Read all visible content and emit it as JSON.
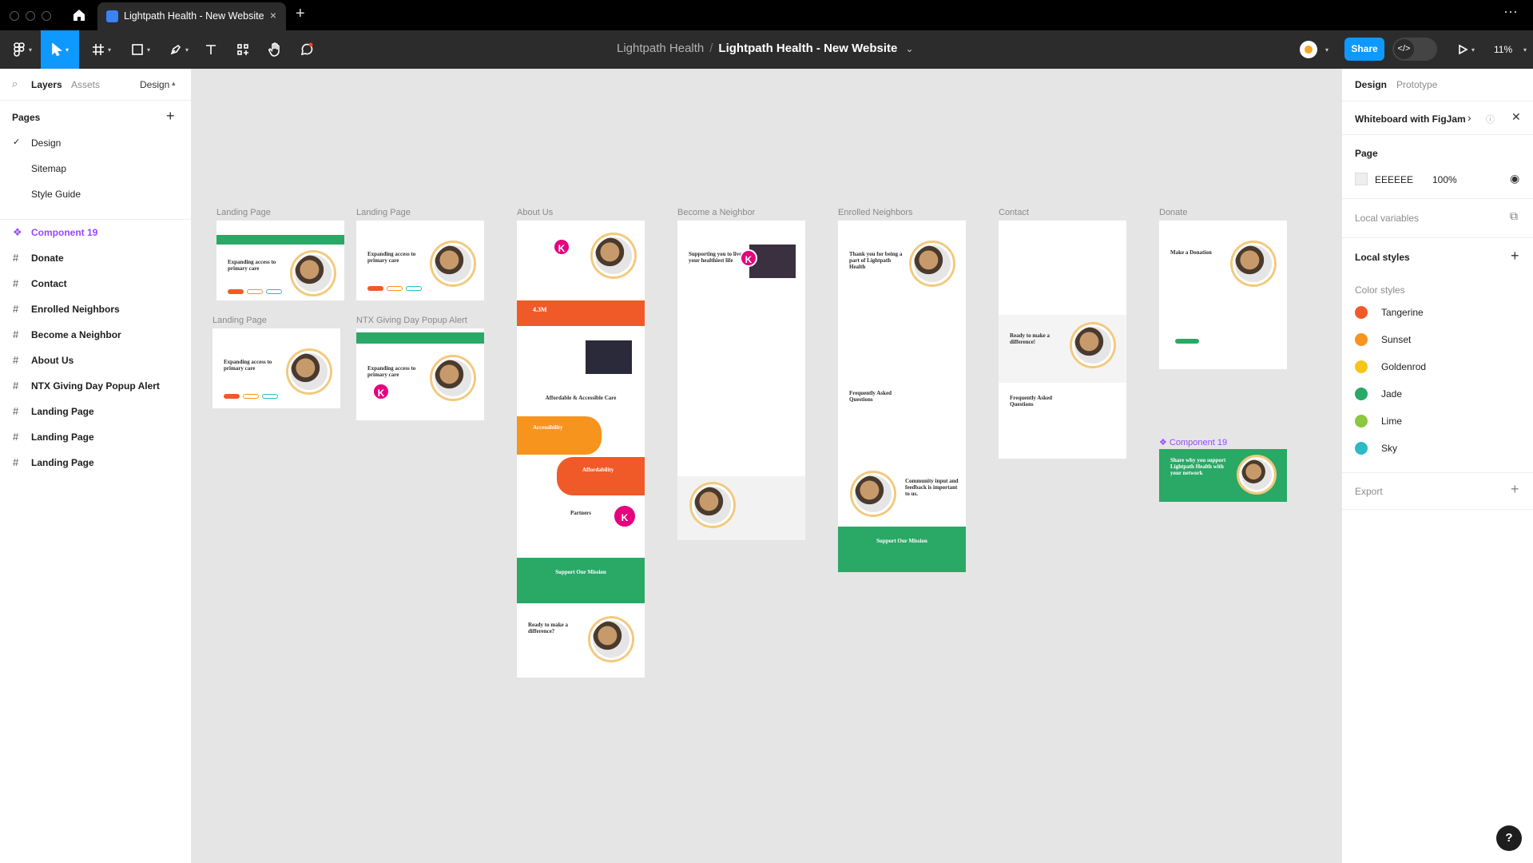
{
  "browser": {
    "tab_title": "Lightpath Health - New Website",
    "tab_close": "×",
    "new_tab": "+",
    "more": "⋯"
  },
  "toolbar": {
    "team": "Lightpath Health",
    "separator": "/",
    "file": "Lightpath Health - New Website",
    "file_caret": "⌄",
    "share_label": "Share",
    "zoom": "11%",
    "dev_mode": "</>"
  },
  "left_panel": {
    "tabs": [
      "Layers",
      "Assets"
    ],
    "page_selector": "Design",
    "pages_title": "Pages",
    "add_page": "+",
    "pages": [
      {
        "label": "Design",
        "selected": true
      },
      {
        "label": "Sitemap",
        "selected": false
      },
      {
        "label": "Style Guide",
        "selected": false
      }
    ],
    "layers": [
      {
        "label": "Component 19",
        "type": "component"
      },
      {
        "label": "Donate",
        "type": "frame"
      },
      {
        "label": "Contact",
        "type": "frame"
      },
      {
        "label": "Enrolled Neighbors",
        "type": "frame"
      },
      {
        "label": "Become a Neighbor",
        "type": "frame"
      },
      {
        "label": "About Us",
        "type": "frame"
      },
      {
        "label": "NTX Giving Day Popup Alert",
        "type": "frame"
      },
      {
        "label": "Landing Page",
        "type": "frame"
      },
      {
        "label": "Landing Page",
        "type": "frame"
      },
      {
        "label": "Landing Page",
        "type": "frame"
      }
    ],
    "check_glyph": "✓",
    "frame_glyph": "#",
    "component_glyph": "❖"
  },
  "canvas": {
    "background": "#e5e5e5",
    "frame_labels": {
      "landing_1": "Landing Page",
      "landing_2": "Landing Page",
      "landing_3": "Landing Page",
      "ntx_popup": "NTX Giving Day Popup Alert",
      "about": "About Us",
      "become": "Become a Neighbor",
      "enrolled": "Enrolled Neighbors",
      "contact": "Contact",
      "donate": "Donate",
      "component": "❖ Component 19"
    },
    "mock_text": {
      "landing_headline": "Expanding access to primary care",
      "about_stat": "4.3M",
      "about_affordable": "Affordable & Accessible Care",
      "about_accessibility": "Accessibility",
      "about_affordability": "Affordability",
      "about_partners": "Partners",
      "about_support": "Support Our Mission",
      "about_ready": "Ready to make a difference?",
      "become_headline": "Supporting you to live your healthiest life",
      "enrolled_headline": "Thank you for being a part of Lightpath Health",
      "enrolled_faq": "Frequently Asked Questions",
      "enrolled_community": "Community input and feedback is important to us.",
      "enrolled_support": "Support Our Mission",
      "contact_ready": "Ready to make a difference!",
      "contact_faq": "Frequently Asked Questions",
      "donate_headline": "Make a Donation",
      "component_text": "Share why you support Lightpath Health with your network",
      "k_badge": "K"
    }
  },
  "right_panel": {
    "tabs": [
      "Design",
      "Prototype"
    ],
    "whiteboard": "Whiteboard with FigJam",
    "page_title": "Page",
    "page_color": "EEEEEE",
    "page_opacity": "100%",
    "local_variables": "Local variables",
    "local_styles": "Local styles",
    "color_styles_title": "Color styles",
    "color_styles": [
      {
        "name": "Tangerine",
        "color": "#f05a28"
      },
      {
        "name": "Sunset",
        "color": "#f7941d"
      },
      {
        "name": "Goldenrod",
        "color": "#f5c518"
      },
      {
        "name": "Jade",
        "color": "#2aa866"
      },
      {
        "name": "Lime",
        "color": "#8dc63f"
      },
      {
        "name": "Sky",
        "color": "#2fb8c6"
      }
    ],
    "export": "Export",
    "add": "+"
  },
  "help": "?"
}
